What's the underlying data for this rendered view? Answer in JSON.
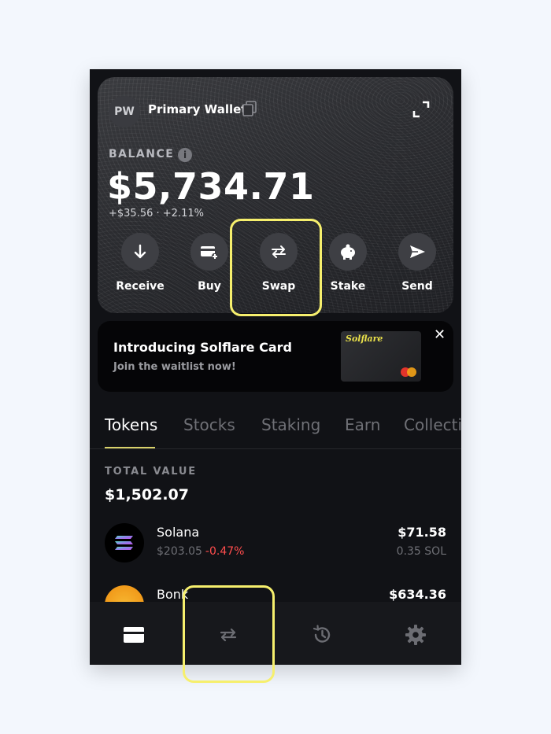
{
  "wallet": {
    "avatar_initials": "PW",
    "name": "Primary Wallet",
    "balance_label": "BALANCE",
    "info_glyph": "i",
    "balance": "$5,734.71",
    "change": "+$35.56 · +2.11%"
  },
  "actions": [
    {
      "label": "Receive",
      "icon": "arrow-down-icon"
    },
    {
      "label": "Buy",
      "icon": "card-plus-icon"
    },
    {
      "label": "Swap",
      "icon": "swap-icon"
    },
    {
      "label": "Stake",
      "icon": "piggy-bank-icon"
    },
    {
      "label": "Send",
      "icon": "paper-plane-icon"
    }
  ],
  "promo": {
    "title": "Introducing Solflare Card",
    "subtitle": "Join the waitlist now!",
    "card_brand": "Solflare",
    "close_glyph": "✕"
  },
  "tabs": [
    {
      "label": "Tokens",
      "active": true
    },
    {
      "label": "Stocks",
      "active": false
    },
    {
      "label": "Staking",
      "active": false
    },
    {
      "label": "Earn",
      "active": false
    },
    {
      "label": "Collecti",
      "active": false
    }
  ],
  "portfolio": {
    "total_label": "TOTAL VALUE",
    "total_value": "$1,502.07"
  },
  "tokens": [
    {
      "name": "Solana",
      "price": "$203.05",
      "change": "-0.47%",
      "usd_value": "$71.58",
      "amount": "0.35 SOL",
      "icon": "solana-logo-icon"
    },
    {
      "name": "Bonk",
      "price": "",
      "change": "",
      "usd_value": "$634.36",
      "amount": "",
      "icon": "bonk-logo-icon"
    }
  ],
  "bottom_nav": [
    {
      "name": "wallet",
      "icon": "wallet-icon",
      "active": true
    },
    {
      "name": "swap",
      "icon": "swap-icon",
      "active": false
    },
    {
      "name": "history",
      "icon": "history-icon",
      "active": false
    },
    {
      "name": "settings",
      "icon": "gear-icon",
      "active": false
    }
  ],
  "colors": {
    "highlight": "#f6ef6d",
    "negative": "#ff4d4d",
    "accent_underline": "#d9d26a",
    "background": "#111216"
  }
}
